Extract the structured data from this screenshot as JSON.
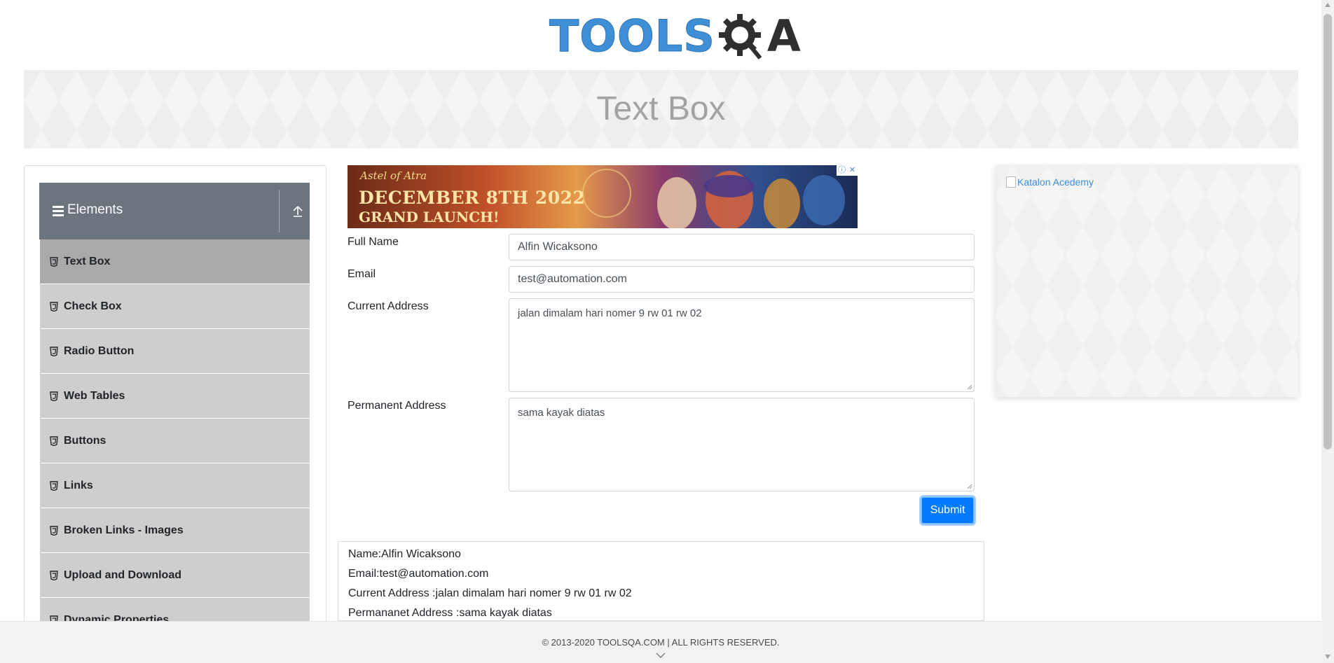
{
  "header": {
    "logo_left": "TOOLS",
    "logo_right": "A",
    "banner_title": "Text Box"
  },
  "sidebar": {
    "group_title": "Elements",
    "items": [
      {
        "label": "Text Box",
        "active": true
      },
      {
        "label": "Check Box"
      },
      {
        "label": "Radio Button"
      },
      {
        "label": "Web Tables"
      },
      {
        "label": "Buttons"
      },
      {
        "label": "Links"
      },
      {
        "label": "Broken Links - Images"
      },
      {
        "label": "Upload and Download"
      },
      {
        "label": "Dynamic Properties"
      }
    ]
  },
  "ad": {
    "brand": "Astel of Atra",
    "line1": "DECEMBER 8TH 2022",
    "line2": "GRAND LAUNCH!"
  },
  "form": {
    "full_name_label": "Full Name",
    "full_name_value": "Alfin Wicaksono",
    "email_label": "Email",
    "email_value": "test@automation.com",
    "current_address_label": "Current Address",
    "current_address_value": "jalan dimalam hari nomer 9 rw 01 rw 02",
    "permanent_address_label": "Permanent Address",
    "permanent_address_value": "sama kayak diatas",
    "submit_label": "Submit"
  },
  "output": {
    "name": "Name:Alfin Wicaksono",
    "email": "Email:test@automation.com",
    "current_address": "Current Address :jalan dimalam hari nomer 9 rw 01 rw 02",
    "permanent_address": "Permananet Address :sama kayak diatas"
  },
  "right_ad": {
    "alt_text": "Katalon Acedemy"
  },
  "footer": {
    "copyright": "© 2013-2020 TOOLSQA.COM | ALL RIGHTS RESERVED."
  },
  "colors": {
    "accent": "#007bff",
    "sidebar_header": "#6c757d",
    "menu_item": "#cecece",
    "menu_active": "#aaaaaa",
    "logo_blue": "#3f8fd6"
  }
}
